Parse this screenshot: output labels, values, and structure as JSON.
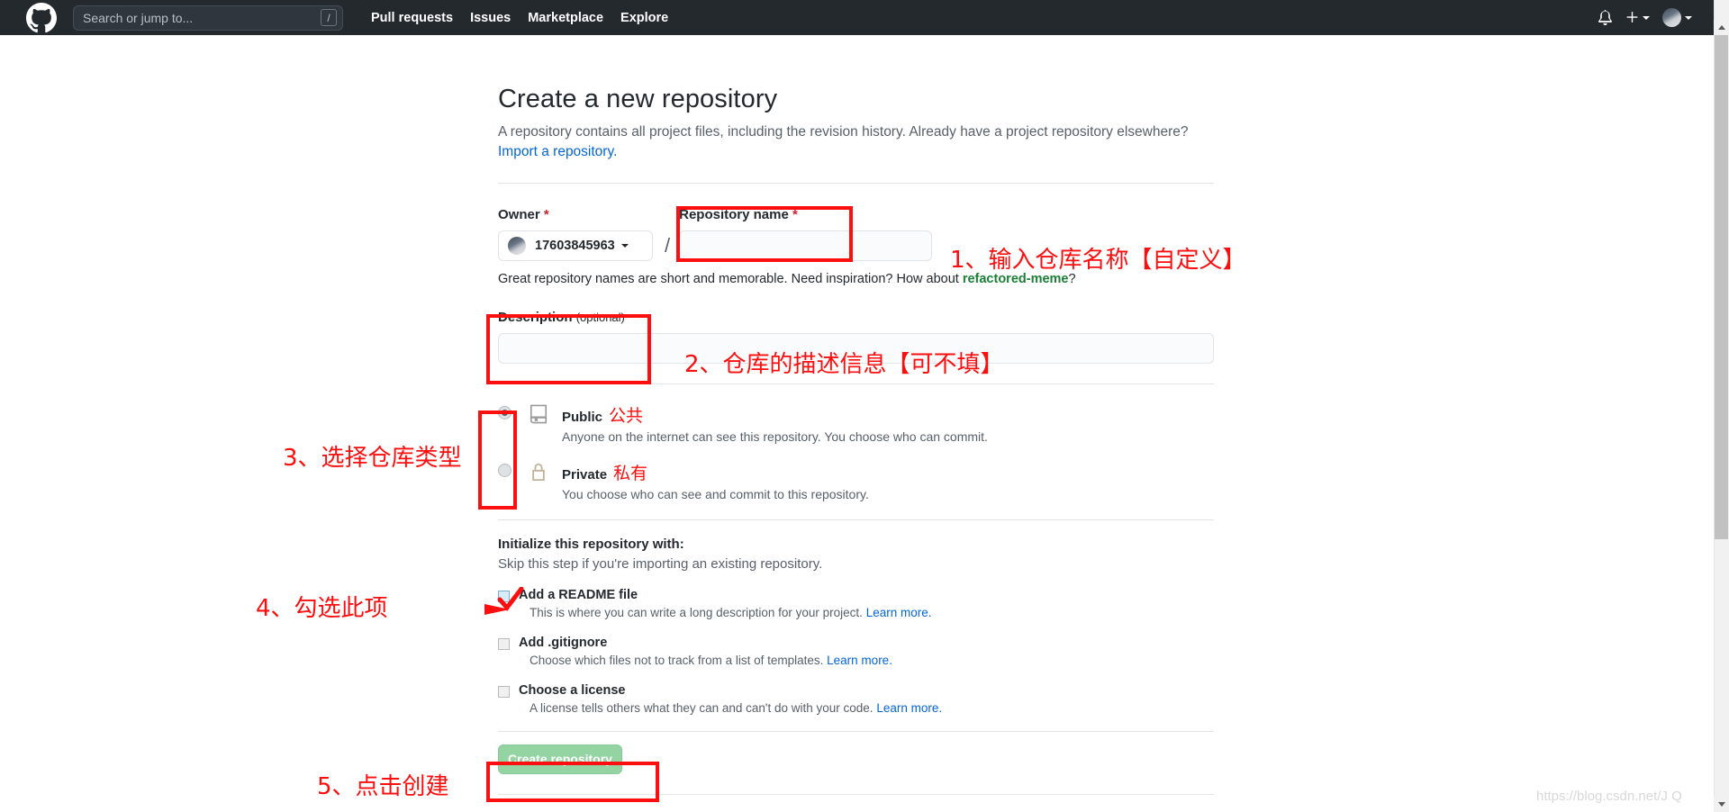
{
  "topbar": {
    "logo_icon": "github-logo-icon",
    "search": {
      "placeholder": "Search or jump to...",
      "shortcut_badge": "/"
    },
    "nav": [
      {
        "label": "Pull requests"
      },
      {
        "label": "Issues"
      },
      {
        "label": "Marketplace"
      },
      {
        "label": "Explore"
      }
    ],
    "notifications_icon": "bell-icon",
    "create_new_icon": "plus-icon",
    "account_icon": "avatar-icon"
  },
  "page": {
    "title": "Create a new repository",
    "subtitle_1": "A repository contains all project files, including the revision history. Already have a project repository elsewhere?",
    "import_link": "Import a repository."
  },
  "form": {
    "owner": {
      "label": "Owner",
      "required_mark": "*",
      "value": "17603845963",
      "caret_icon": "chevron-down-icon"
    },
    "separator": "/",
    "repo_name": {
      "label": "Repository name",
      "required_mark": "*",
      "value": "",
      "placeholder": ""
    },
    "name_hint_before": "Great repository names are short and memorable. Need inspiration? How about ",
    "name_hint_suggestion": "refactored-meme",
    "name_hint_after": "?",
    "description": {
      "label": "Description",
      "optional": "(optional)",
      "value": "",
      "placeholder": ""
    },
    "visibility": [
      {
        "id": "public",
        "icon": "repo-book-icon",
        "title": "Public",
        "title_cn": "公共",
        "description": "Anyone on the internet can see this repository. You choose who can commit.",
        "selected": true
      },
      {
        "id": "private",
        "icon": "lock-icon",
        "title": "Private",
        "title_cn": "私有",
        "description": "You choose who can see and commit to this repository.",
        "selected": false
      }
    ],
    "initialize": {
      "heading": "Initialize this repository with:",
      "subheading": "Skip this step if you're importing an existing repository.",
      "options": [
        {
          "id": "readme",
          "title": "Add a README file",
          "description": "This is where you can write a long description for your project.",
          "learn_more": "Learn more.",
          "checked": true
        },
        {
          "id": "gitignore",
          "title": "Add .gitignore",
          "description": "Choose which files not to track from a list of templates.",
          "learn_more": "Learn more.",
          "checked": false
        },
        {
          "id": "license",
          "title": "Choose a license",
          "description": "A license tells others what they can and can't do with your code.",
          "learn_more": "Learn more.",
          "checked": false
        }
      ]
    },
    "submit_label": "Create repository"
  },
  "annotations": [
    {
      "id": "step1",
      "text": "1、输入仓库名称【自定义】"
    },
    {
      "id": "step2",
      "text": "2、仓库的描述信息【可不填】"
    },
    {
      "id": "step3",
      "text": "3、选择仓库类型"
    },
    {
      "id": "step4",
      "text": "4、勾选此项"
    },
    {
      "id": "step5",
      "text": "5、点击创建"
    }
  ],
  "watermark": "https://blog.csdn.net/J            Q",
  "colors": {
    "annotation_red": "#fd0e0e",
    "topbar_bg": "#24292e",
    "link_blue": "#0366d6",
    "suggestion_green": "#1a7f37",
    "button_green": "#94d3a2"
  }
}
